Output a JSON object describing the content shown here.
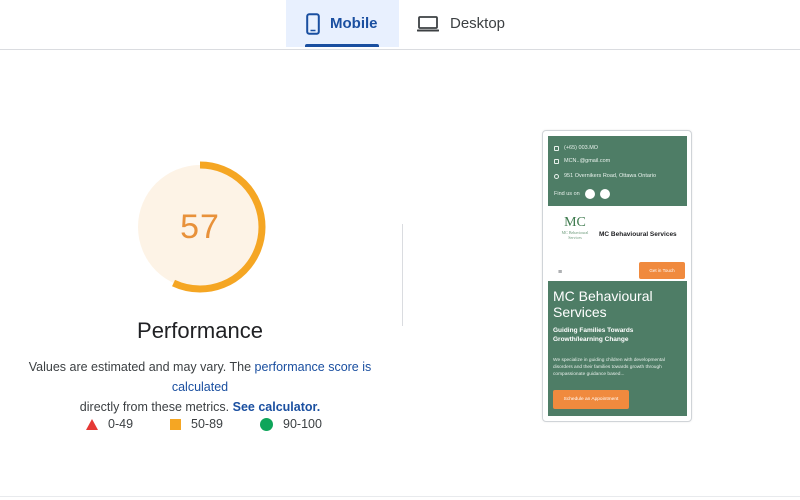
{
  "tabs": {
    "mobile": {
      "label": "Mobile",
      "icon": "smartphone-icon",
      "selected": true
    },
    "desktop": {
      "label": "Desktop",
      "icon": "laptop-icon",
      "selected": false
    }
  },
  "colors": {
    "accent": "#1a4fa0",
    "average": "#f5a623",
    "poor": "#e53935",
    "good": "#0ea55a",
    "gauge_fill": "#fdf3e6",
    "preview_green": "#4e7d66",
    "preview_orange": "#f08a3e"
  },
  "score": {
    "value": "57",
    "fraction": 0.57,
    "label": "Performance"
  },
  "description": {
    "prefix": "Values are estimated and may vary. The ",
    "link_text": "performance score is calculated",
    "middle": " directly from these metrics. ",
    "calc_link": "See calculator."
  },
  "legend": [
    {
      "range": "0-49",
      "shape": "triangle",
      "color": "#e53935"
    },
    {
      "range": "50-89",
      "shape": "square",
      "color": "#f5a623"
    },
    {
      "range": "90-100",
      "shape": "circle",
      "color": "#0ea55a"
    }
  ],
  "preview": {
    "phone": "(+65) 003.MO",
    "email": "MCN..@gmail.com",
    "address": "951 Overnikers Road, Ottawa Ontario",
    "find_us": "Find us on",
    "logo_text": "MC",
    "logo_sub": "MC Behavioural Services",
    "brand": "MC Behavioural Services",
    "menu": "≡",
    "header_button": "Get in Touch",
    "hero_title": "MC Behavioural Services",
    "hero_subtitle": "Guiding Families Towards Growth/learning Change",
    "hero_text": "We specialize in guiding children with developmental disorders and their families towards growth through compassionate guidance based...",
    "cta": "Schedule an Appointment"
  }
}
